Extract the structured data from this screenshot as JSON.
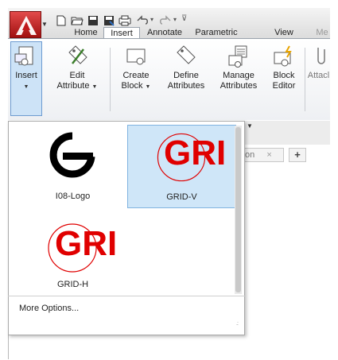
{
  "qat": {
    "icons": [
      "new-icon",
      "open-icon",
      "save-icon",
      "save-as-icon",
      "plot-icon",
      "undo-icon",
      "redo-icon",
      "customize-icon"
    ]
  },
  "tabs": [
    {
      "label": "Home"
    },
    {
      "label": "Insert"
    },
    {
      "label": "Annotate"
    },
    {
      "label": "Parametric"
    },
    {
      "label": "View"
    },
    {
      "label": "Me"
    }
  ],
  "active_tab": "Insert",
  "ribbon": {
    "insert": {
      "label": "Insert"
    },
    "edit_attribute": {
      "line1": "Edit",
      "line2": "Attribute"
    },
    "create_block": {
      "line1": "Create",
      "line2": "Block"
    },
    "define_attributes": {
      "line1": "Define",
      "line2": "Attributes"
    },
    "manage_attributes": {
      "line1": "Manage",
      "line2": "Attributes"
    },
    "block_editor": {
      "line1": "Block",
      "line2": "Editor"
    },
    "attach": {
      "label": "Attacl"
    }
  },
  "doc_tab": {
    "label": "on",
    "close": "×",
    "plus": "+"
  },
  "gallery": {
    "items": [
      {
        "label": "I08-Logo",
        "thumb_text": ""
      },
      {
        "label": "GRID-V",
        "thumb_text": "GRI"
      },
      {
        "label": "GRID-H",
        "thumb_text": "GRI"
      }
    ],
    "selected": "GRID-V",
    "more_options": "More Options..."
  },
  "colors": {
    "accent_red": "#e00000",
    "selection": "#cfe6f8",
    "app_red": "#c0191c"
  }
}
